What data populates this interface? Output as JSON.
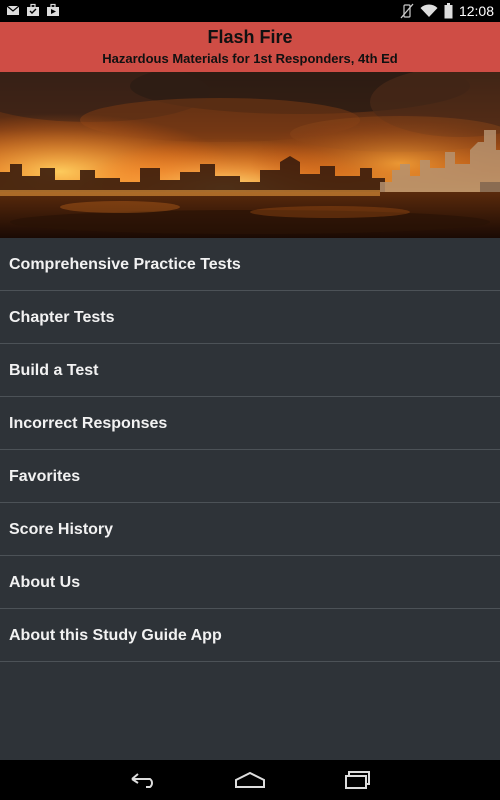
{
  "status_bar": {
    "time": "12:08",
    "icons": [
      "mail-icon",
      "briefcase-icon",
      "bag-icon",
      "vibrate-off-icon",
      "wifi-icon",
      "battery-icon"
    ]
  },
  "header": {
    "title": "Flash Fire",
    "subtitle": "Hazardous Materials for 1st Responders, 4th Ed",
    "accent_color": "#cf4d45"
  },
  "menu": {
    "items": [
      {
        "label": "Comprehensive Practice Tests"
      },
      {
        "label": "Chapter Tests"
      },
      {
        "label": "Build a Test"
      },
      {
        "label": "Incorrect Responses"
      },
      {
        "label": "Favorites"
      },
      {
        "label": "Score History"
      },
      {
        "label": "About Us"
      },
      {
        "label": "About this Study Guide App"
      }
    ]
  },
  "nav_bar": {
    "buttons": [
      "back-icon",
      "home-icon",
      "recent-apps-icon"
    ]
  }
}
